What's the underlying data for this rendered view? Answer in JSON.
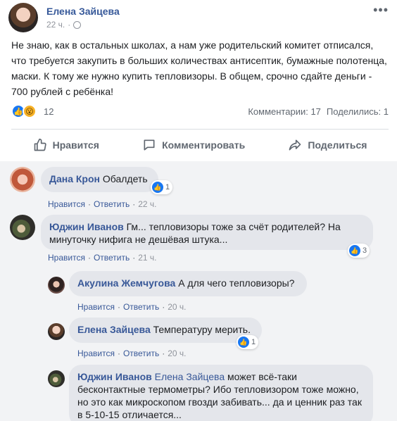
{
  "post": {
    "author": "Елена Зайцева",
    "time": "22 ч.",
    "more_glyph": "•••",
    "text": "Не знаю, как в остальных школах, а нам уже родительский комитет отписался, что требуется закупить в больших количествах антисептик, бумажные полотенца, маски. К тому же нужно купить тепловизоры. В общем, срочно сдайте деньги - 700 рублей с ребёнка!",
    "reactions_count": "12",
    "comments_count": "Комментарии: 17",
    "shares_count": "Поделились: 1"
  },
  "actions": {
    "like": "Нравится",
    "comment": "Комментировать",
    "share": "Поделиться"
  },
  "comments": [
    {
      "name": "Дана Крон",
      "text": "Обалдеть",
      "like_label": "Нравится",
      "reply_label": "Ответить",
      "time": "22 ч.",
      "reactions": "1"
    },
    {
      "name": "Юджин Иванов",
      "text": "Гм... тепловизоры тоже за счёт родителей? На минуточку нифига не дешёвая штука...",
      "like_label": "Нравится",
      "reply_label": "Ответить",
      "time": "21 ч.",
      "reactions": "3"
    },
    {
      "name": "Акулина Жемчугова",
      "text": "А для чего тепловизоры?",
      "like_label": "Нравится",
      "reply_label": "Ответить",
      "time": "20 ч."
    },
    {
      "name": "Елена Зайцева",
      "text": "Температуру мерить.",
      "like_label": "Нравится",
      "reply_label": "Ответить",
      "time": "20 ч.",
      "reactions": "1"
    },
    {
      "name": "Юджин Иванов",
      "mention": "Елена Зайцева",
      "text": "может всё-таки бесконтактные термометры? Ибо тепловизором тоже можно, но это как микроскопом гвозди забивать... да и ценник раз так в 5-10-15 отличается..."
    }
  ],
  "separator": "·",
  "icons": {
    "like_glyph": "👍",
    "wow_glyph": "😮"
  }
}
